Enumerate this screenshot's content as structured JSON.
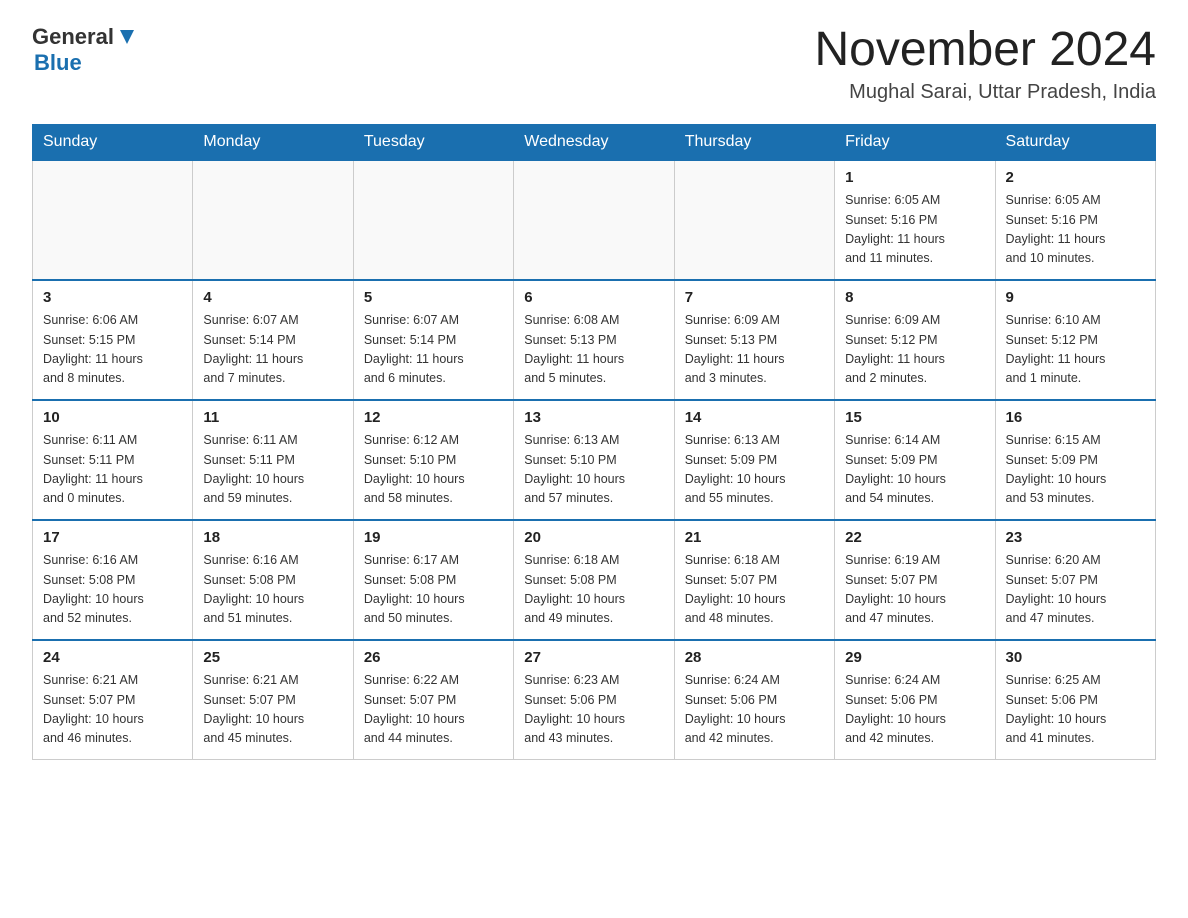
{
  "logo": {
    "general": "General",
    "blue": "Blue"
  },
  "header": {
    "month": "November 2024",
    "location": "Mughal Sarai, Uttar Pradesh, India"
  },
  "weekdays": [
    "Sunday",
    "Monday",
    "Tuesday",
    "Wednesday",
    "Thursday",
    "Friday",
    "Saturday"
  ],
  "weeks": [
    [
      {
        "day": "",
        "info": ""
      },
      {
        "day": "",
        "info": ""
      },
      {
        "day": "",
        "info": ""
      },
      {
        "day": "",
        "info": ""
      },
      {
        "day": "",
        "info": ""
      },
      {
        "day": "1",
        "info": "Sunrise: 6:05 AM\nSunset: 5:16 PM\nDaylight: 11 hours\nand 11 minutes."
      },
      {
        "day": "2",
        "info": "Sunrise: 6:05 AM\nSunset: 5:16 PM\nDaylight: 11 hours\nand 10 minutes."
      }
    ],
    [
      {
        "day": "3",
        "info": "Sunrise: 6:06 AM\nSunset: 5:15 PM\nDaylight: 11 hours\nand 8 minutes."
      },
      {
        "day": "4",
        "info": "Sunrise: 6:07 AM\nSunset: 5:14 PM\nDaylight: 11 hours\nand 7 minutes."
      },
      {
        "day": "5",
        "info": "Sunrise: 6:07 AM\nSunset: 5:14 PM\nDaylight: 11 hours\nand 6 minutes."
      },
      {
        "day": "6",
        "info": "Sunrise: 6:08 AM\nSunset: 5:13 PM\nDaylight: 11 hours\nand 5 minutes."
      },
      {
        "day": "7",
        "info": "Sunrise: 6:09 AM\nSunset: 5:13 PM\nDaylight: 11 hours\nand 3 minutes."
      },
      {
        "day": "8",
        "info": "Sunrise: 6:09 AM\nSunset: 5:12 PM\nDaylight: 11 hours\nand 2 minutes."
      },
      {
        "day": "9",
        "info": "Sunrise: 6:10 AM\nSunset: 5:12 PM\nDaylight: 11 hours\nand 1 minute."
      }
    ],
    [
      {
        "day": "10",
        "info": "Sunrise: 6:11 AM\nSunset: 5:11 PM\nDaylight: 11 hours\nand 0 minutes."
      },
      {
        "day": "11",
        "info": "Sunrise: 6:11 AM\nSunset: 5:11 PM\nDaylight: 10 hours\nand 59 minutes."
      },
      {
        "day": "12",
        "info": "Sunrise: 6:12 AM\nSunset: 5:10 PM\nDaylight: 10 hours\nand 58 minutes."
      },
      {
        "day": "13",
        "info": "Sunrise: 6:13 AM\nSunset: 5:10 PM\nDaylight: 10 hours\nand 57 minutes."
      },
      {
        "day": "14",
        "info": "Sunrise: 6:13 AM\nSunset: 5:09 PM\nDaylight: 10 hours\nand 55 minutes."
      },
      {
        "day": "15",
        "info": "Sunrise: 6:14 AM\nSunset: 5:09 PM\nDaylight: 10 hours\nand 54 minutes."
      },
      {
        "day": "16",
        "info": "Sunrise: 6:15 AM\nSunset: 5:09 PM\nDaylight: 10 hours\nand 53 minutes."
      }
    ],
    [
      {
        "day": "17",
        "info": "Sunrise: 6:16 AM\nSunset: 5:08 PM\nDaylight: 10 hours\nand 52 minutes."
      },
      {
        "day": "18",
        "info": "Sunrise: 6:16 AM\nSunset: 5:08 PM\nDaylight: 10 hours\nand 51 minutes."
      },
      {
        "day": "19",
        "info": "Sunrise: 6:17 AM\nSunset: 5:08 PM\nDaylight: 10 hours\nand 50 minutes."
      },
      {
        "day": "20",
        "info": "Sunrise: 6:18 AM\nSunset: 5:08 PM\nDaylight: 10 hours\nand 49 minutes."
      },
      {
        "day": "21",
        "info": "Sunrise: 6:18 AM\nSunset: 5:07 PM\nDaylight: 10 hours\nand 48 minutes."
      },
      {
        "day": "22",
        "info": "Sunrise: 6:19 AM\nSunset: 5:07 PM\nDaylight: 10 hours\nand 47 minutes."
      },
      {
        "day": "23",
        "info": "Sunrise: 6:20 AM\nSunset: 5:07 PM\nDaylight: 10 hours\nand 47 minutes."
      }
    ],
    [
      {
        "day": "24",
        "info": "Sunrise: 6:21 AM\nSunset: 5:07 PM\nDaylight: 10 hours\nand 46 minutes."
      },
      {
        "day": "25",
        "info": "Sunrise: 6:21 AM\nSunset: 5:07 PM\nDaylight: 10 hours\nand 45 minutes."
      },
      {
        "day": "26",
        "info": "Sunrise: 6:22 AM\nSunset: 5:07 PM\nDaylight: 10 hours\nand 44 minutes."
      },
      {
        "day": "27",
        "info": "Sunrise: 6:23 AM\nSunset: 5:06 PM\nDaylight: 10 hours\nand 43 minutes."
      },
      {
        "day": "28",
        "info": "Sunrise: 6:24 AM\nSunset: 5:06 PM\nDaylight: 10 hours\nand 42 minutes."
      },
      {
        "day": "29",
        "info": "Sunrise: 6:24 AM\nSunset: 5:06 PM\nDaylight: 10 hours\nand 42 minutes."
      },
      {
        "day": "30",
        "info": "Sunrise: 6:25 AM\nSunset: 5:06 PM\nDaylight: 10 hours\nand 41 minutes."
      }
    ]
  ]
}
